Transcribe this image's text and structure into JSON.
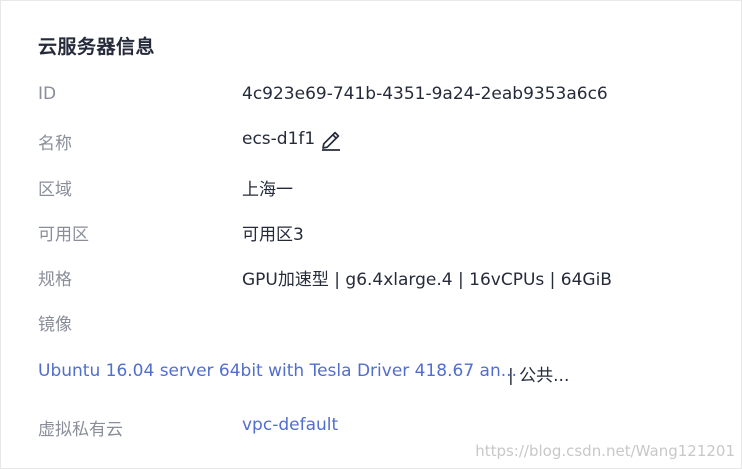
{
  "panel": {
    "title": "云服务器信息"
  },
  "rows": {
    "id": {
      "label": "ID",
      "value": "4c923e69-741b-4351-9a24-2eab9353a6c6"
    },
    "name": {
      "label": "名称",
      "value": "ecs-d1f1"
    },
    "region": {
      "label": "区域",
      "value": "上海一"
    },
    "az": {
      "label": "可用区",
      "value": "可用区3"
    },
    "flavor": {
      "label": "规格",
      "value": "GPU加速型 | g6.4xlarge.4 | 16vCPUs | 64GiB"
    },
    "image": {
      "label": "镜像",
      "link": "Ubuntu 16.04 server 64bit with Tesla Driver 418.67 an...",
      "type": "| 公共..."
    },
    "vpc": {
      "label": "虚拟私有云",
      "value": "vpc-default"
    }
  },
  "watermark": "https://blog.csdn.net/Wang121201",
  "colors": {
    "label": "#8a8e99",
    "value": "#252b3a",
    "link": "#526ecc",
    "border": "#e8e8e8"
  },
  "icons": {
    "edit": "pencil-icon"
  }
}
